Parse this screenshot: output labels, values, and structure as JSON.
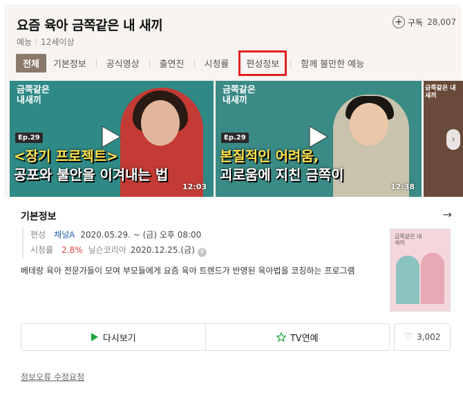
{
  "show": {
    "title": "요즘 육아 금쪽같은 내 새끼",
    "genre": "예능",
    "age_rating": "12세이상"
  },
  "subscribe": {
    "label": "구독",
    "count": "28,007"
  },
  "tabs": [
    {
      "label": "전체",
      "active": true
    },
    {
      "label": "기본정보"
    },
    {
      "label": "공식영상"
    },
    {
      "label": "출연진"
    },
    {
      "label": "시청률"
    },
    {
      "label": "편성정보",
      "highlighted": true
    },
    {
      "label": "함께 볼만한 예능"
    }
  ],
  "videos": [
    {
      "logo": "금쪽같은 내새끼",
      "episode": "Ep.29",
      "caption_line1": "<장기 프로젝트>",
      "caption_line2": "공포와 불안을 이겨내는 법",
      "duration": "12:03"
    },
    {
      "logo": "금쪽같은 내새끼",
      "episode": "Ep.29",
      "caption_line1": "본질적인 어려움,",
      "caption_line2": "괴로움에 지친 금쪽이",
      "duration": "12:38"
    },
    {
      "logo": "금쪽같은 내새끼"
    }
  ],
  "info": {
    "section_title": "기본정보",
    "schedule_key": "편성",
    "channel": "채널A",
    "schedule": "2020.05.29. ~ (금) 오후 08:00",
    "rating_key": "시청률",
    "rating_value": "2.8%",
    "rating_source": "닐슨코리아",
    "rating_date": "2020.12.25.(금)",
    "description": "베테랑 육아 전문가들이 모여 부모들에게 요즘 육아 트렌드가 반영된 육아법을 코칭하는 프로그램",
    "poster_text": "금쪽같은 내새끼"
  },
  "actions": {
    "rewatch": "다시보기",
    "tv_entertainment": "TV연예",
    "likes": "3,002"
  },
  "footer": {
    "report_link": "정보오류 수정요청"
  },
  "colors": {
    "active_tab_bg": "#8a7a6b",
    "highlight_box": "#e02020",
    "rating_red": "#d9413f",
    "channel_blue": "#2563a8"
  }
}
